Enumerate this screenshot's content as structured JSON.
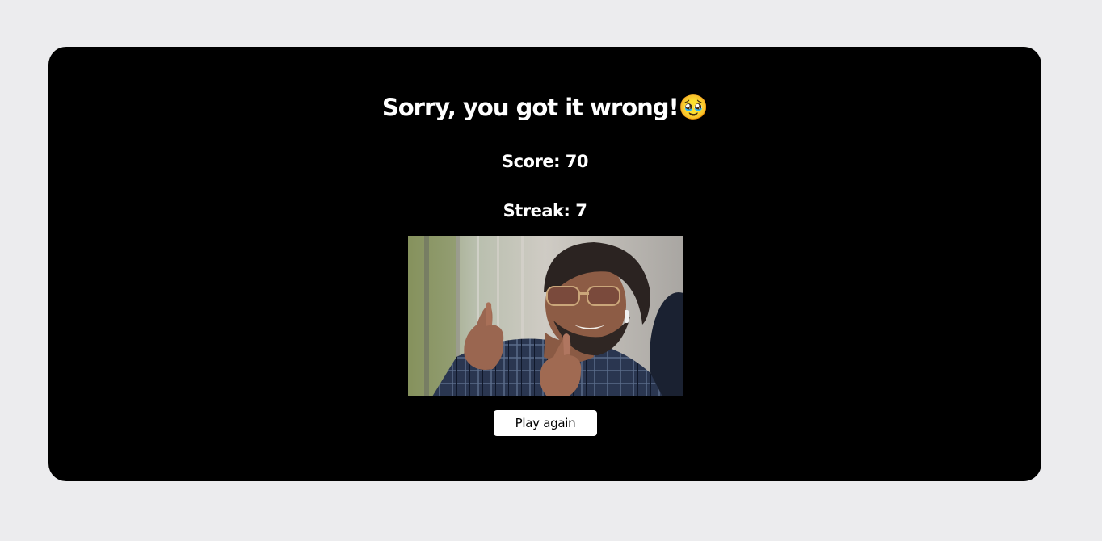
{
  "result": {
    "title": "Sorry, you got it wrong!",
    "emoji": "🥹",
    "score_label": "Score: 70",
    "streak_label": "Streak: 7"
  },
  "image": {
    "alt": "man in sunglasses giving two thumbs up"
  },
  "actions": {
    "play_again_label": "Play again"
  },
  "colors": {
    "page_bg": "#ececee",
    "card_bg": "#000000",
    "text": "#ffffff",
    "button_bg": "#ffffff",
    "button_text": "#000000"
  }
}
